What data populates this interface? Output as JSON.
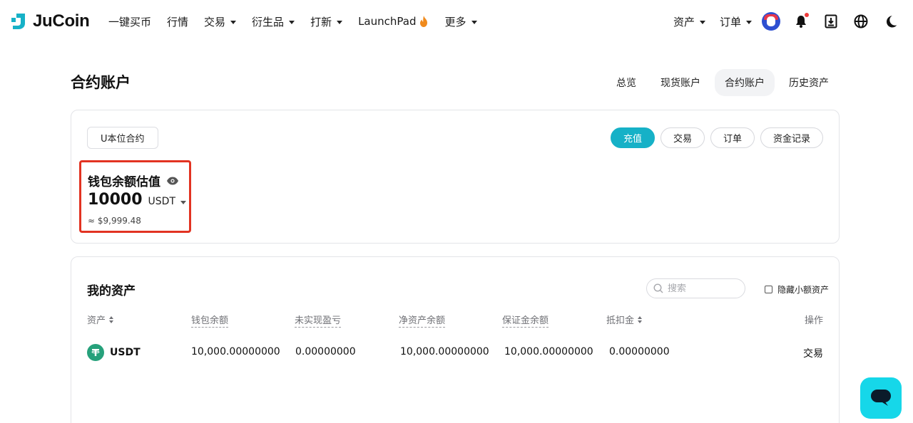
{
  "brand": {
    "name": "JuCoin",
    "accent": "#16b1c7"
  },
  "nav": {
    "items": [
      {
        "label": "一键买币",
        "dropdown": false
      },
      {
        "label": "行情",
        "dropdown": false
      },
      {
        "label": "交易",
        "dropdown": true
      },
      {
        "label": "衍生品",
        "dropdown": true
      },
      {
        "label": "打新",
        "dropdown": true
      },
      {
        "label": "LaunchPad",
        "dropdown": false,
        "icon": "flame-icon"
      },
      {
        "label": "更多",
        "dropdown": true
      }
    ],
    "right": {
      "assets": "资产",
      "orders": "订单",
      "icons": [
        "avatar",
        "bell-icon",
        "download-icon",
        "globe-icon",
        "moon-icon"
      ]
    }
  },
  "page": {
    "title": "合约账户",
    "tabs": [
      {
        "label": "总览",
        "active": false
      },
      {
        "label": "现货账户",
        "active": false
      },
      {
        "label": "合约账户",
        "active": true
      },
      {
        "label": "历史资产",
        "active": false
      }
    ]
  },
  "account": {
    "type_tab": "U本位合约",
    "actions": {
      "deposit": "充值",
      "trade": "交易",
      "orders": "订单",
      "funding": "资金记录"
    },
    "balance": {
      "label": "钱包余额估值",
      "value": "10000",
      "unit": "USDT",
      "usd_estimate": "≈ $9,999.48"
    }
  },
  "assets": {
    "title": "我的资产",
    "search_placeholder": "搜索",
    "hide_small": "隐藏小额资产",
    "columns": [
      "资产",
      "钱包余额",
      "未实现盈亏",
      "净资产余额",
      "保证金余额",
      "抵扣金",
      "操作"
    ],
    "rows": [
      {
        "coin": "USDT",
        "wallet_balance": "10,000.00000000",
        "unrealized_pnl": "0.00000000",
        "net_balance": "10,000.00000000",
        "margin_balance": "10,000.00000000",
        "deduction": "0.00000000",
        "action": "交易"
      }
    ]
  }
}
